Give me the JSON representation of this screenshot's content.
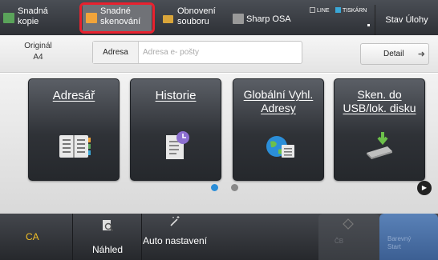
{
  "topbar": {
    "tabs": [
      {
        "label": "Snadná kopie"
      },
      {
        "label": "Snadné skenování"
      },
      {
        "label": "Obnovení souboru"
      },
      {
        "label": "Sharp OSA"
      }
    ],
    "status_line": "LINE",
    "status_printer": "TISKÁRN",
    "jobs_label": "Stav Úlohy"
  },
  "address_row": {
    "original_label": "Originál",
    "original_size": "A4",
    "address_label": "Adresa",
    "address_placeholder": "Adresa e- pošty",
    "detail_label": "Detail"
  },
  "cards": [
    {
      "label": "Adresář",
      "icon": "address-book-icon"
    },
    {
      "label": "Historie",
      "icon": "history-icon"
    },
    {
      "label": "Globální Vyhl. Adresy",
      "icon": "global-address-icon"
    },
    {
      "label": "Sken. do USB/lok. disku",
      "icon": "usb-drive-icon"
    }
  ],
  "pager": {
    "pages": 2,
    "current": 1
  },
  "bottom": {
    "ca_label": "CA",
    "preview_label": "Náhled",
    "auto_label": "Auto nastavení",
    "bw_label": "ČB",
    "color_label": "Barevný Start"
  },
  "colors": {
    "highlight": "#e8212e",
    "accent_blue": "#2b8ed8",
    "ca_yellow": "#f2c027"
  }
}
